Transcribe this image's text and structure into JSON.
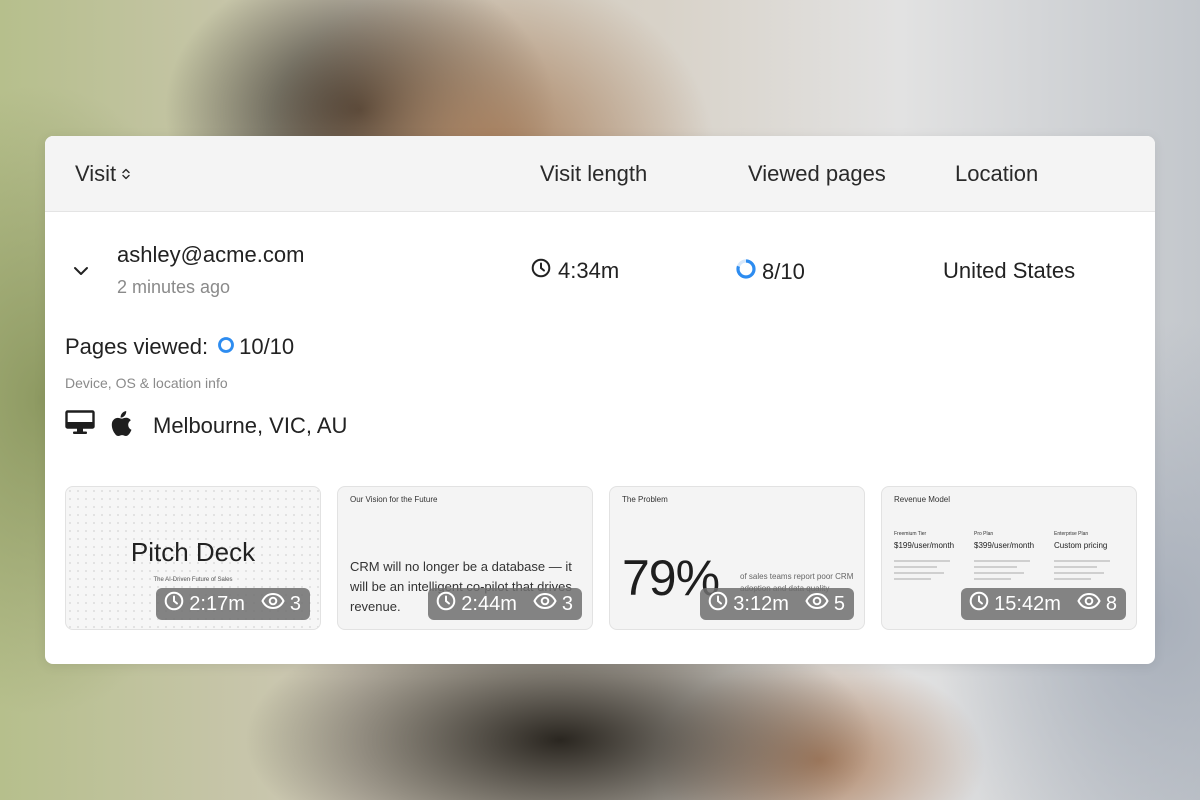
{
  "table": {
    "columns": {
      "visit": "Visit",
      "visit_length": "Visit length",
      "viewed_pages": "Viewed pages",
      "location": "Location"
    }
  },
  "visit": {
    "email": "ashley@acme.com",
    "time_ago": "2 minutes ago",
    "length": "4:34m",
    "viewed_pages": "8/10",
    "viewed_progress": 0.8,
    "location": "United States"
  },
  "details": {
    "pages_viewed_label": "Pages viewed:",
    "pages_viewed_value": "10/10",
    "pages_viewed_progress": 1.0,
    "device_info_label": "Device, OS & location info",
    "device_icon": "desktop-icon",
    "os_icon": "apple-icon",
    "city": "Melbourne, VIC, AU"
  },
  "slides": [
    {
      "title": "Pitch Deck",
      "subtitle": "The AI-Driven Future of Sales",
      "duration": "2:17m",
      "views": "3"
    },
    {
      "heading": "Our Vision for the Future",
      "quote": "CRM will no longer be a database — it will be an intelligent co-pilot that drives revenue.",
      "duration": "2:44m",
      "views": "3"
    },
    {
      "heading": "The Problem",
      "stat": "79%",
      "stat_text": "of sales teams report poor CRM adoption and data quality",
      "duration": "3:12m",
      "views": "5"
    },
    {
      "heading": "Revenue Model",
      "plans": [
        {
          "name": "Freemium Tier",
          "price": "$199/user/month"
        },
        {
          "name": "Pro Plan",
          "price": "$399/user/month"
        },
        {
          "name": "Enterprise Plan",
          "price": "Custom pricing"
        }
      ],
      "duration": "15:42m",
      "views": "8"
    }
  ],
  "colors": {
    "progress_ring": "#2d8cf0",
    "badge_bg": "#6e6e6e"
  }
}
